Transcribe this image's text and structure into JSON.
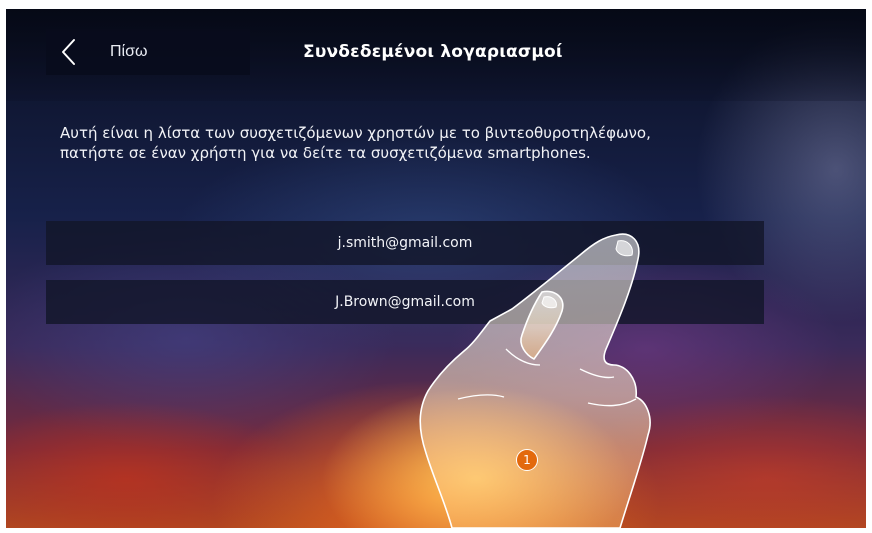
{
  "header": {
    "back_label": "Πίσω",
    "title": "Συνδεδεμένοι λογαριασμοί"
  },
  "description": {
    "line1": "Αυτή είναι η λίστα των συσχετιζόμενων χρηστών με το βιντεοθυροτηλέφωνο,",
    "line2": "πατήστε σε έναν χρήστη για να δείτε τα συσχετιζόμενα smartphones."
  },
  "accounts": [
    {
      "email": "j.smith@gmail.com"
    },
    {
      "email": "J.Brown@gmail.com"
    }
  ],
  "annotation": {
    "step": "1",
    "badge_color": "#e3690d"
  },
  "icons": {
    "back": "chevron-left-icon",
    "hand": "hand-pointer-icon"
  }
}
